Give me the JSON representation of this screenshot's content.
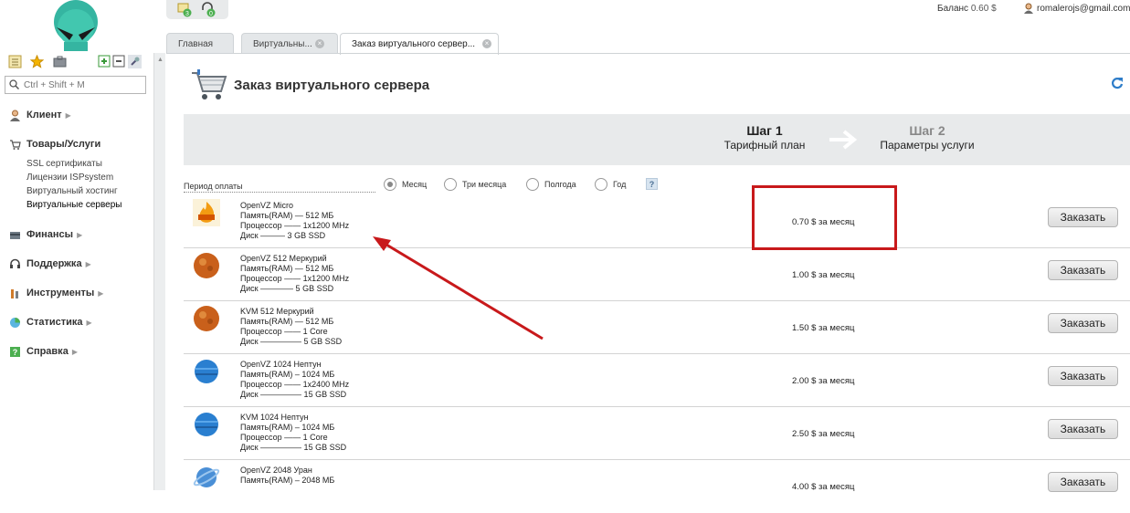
{
  "header": {
    "balance_label": "Баланс",
    "balance_value": "0.60 $",
    "user_email": "romalerojs@gmail.com",
    "top_badges": [
      "3",
      "0"
    ]
  },
  "search": {
    "placeholder": "Ctrl + Shift + M"
  },
  "sidebar": {
    "sections": [
      {
        "label": "Клиент",
        "icon": "client-icon"
      },
      {
        "label": "Товары/Услуги",
        "icon": "cart-icon",
        "items": [
          "SSL сертификаты",
          "Лицензии ISPsystem",
          "Виртуальный хостинг",
          "Виртуальные серверы"
        ]
      },
      {
        "label": "Финансы",
        "icon": "finance-icon"
      },
      {
        "label": "Поддержка",
        "icon": "headset-icon"
      },
      {
        "label": "Инструменты",
        "icon": "tools-icon"
      },
      {
        "label": "Статистика",
        "icon": "stats-icon"
      },
      {
        "label": "Справка",
        "icon": "help-icon"
      }
    ]
  },
  "tabs": [
    {
      "label": "Главная"
    },
    {
      "label": "Виртуальны..."
    },
    {
      "label": "Заказ виртуального сервер..."
    }
  ],
  "page": {
    "title": "Заказ виртуального сервера",
    "step1_num": "Шаг 1",
    "step1_name": "Тарифный план",
    "step2_num": "Шаг 2",
    "step2_name": "Параметры услуги",
    "period_label": "Период оплаты",
    "periods": [
      "Месяц",
      "Три месяца",
      "Полгода",
      "Год"
    ],
    "period_selected": "Месяц",
    "help": "?"
  },
  "plans": [
    {
      "name": "OpenVZ Micro",
      "ram": "Память(RAM) — 512 МБ",
      "cpu": "Процессор —— 1x1200 MHz",
      "disk": "Диск ——— 3 GB SSD",
      "price": "0.70 $ за месяц",
      "button": "Заказать",
      "icon": "hot-price-icon"
    },
    {
      "name": "OpenVZ 512 Меркурий",
      "ram": "Память(RAM) — 512 МБ",
      "cpu": "Процессор —— 1x1200 MHz",
      "disk": "Диск ———— 5 GB SSD",
      "price": "1.00 $ за месяц",
      "button": "Заказать",
      "icon": "mercury-planet-icon"
    },
    {
      "name": "KVM 512 Меркурий",
      "ram": "Память(RAM) — 512 МБ",
      "cpu": "Процессор —— 1 Core",
      "disk": "Диск ————— 5 GB SSD",
      "price": "1.50 $ за месяц",
      "button": "Заказать",
      "icon": "mercury-planet-icon"
    },
    {
      "name": "OpenVZ 1024 Нептун",
      "ram": "Память(RAM) – 1024 МБ",
      "cpu": "Процессор —— 1x2400 MHz",
      "disk": "Диск ————— 15 GB SSD",
      "price": "2.00 $ за месяц",
      "button": "Заказать",
      "icon": "neptune-planet-icon"
    },
    {
      "name": "KVM 1024 Нептун",
      "ram": "Память(RAM) – 1024 МБ",
      "cpu": "Процессор —— 1 Core",
      "disk": "Диск ————— 15 GB SSD",
      "price": "2.50 $ за месяц",
      "button": "Заказать",
      "icon": "neptune-planet-icon"
    },
    {
      "name": "OpenVZ 2048 Уран",
      "ram": "Память(RAM) – 2048 МБ",
      "cpu": "",
      "disk": "",
      "price": "4.00 $ за месяц",
      "button": "Заказать",
      "icon": "uranus-planet-icon"
    }
  ],
  "colors": {
    "highlight": "#c8191b",
    "panel": "#e8eaeb"
  }
}
